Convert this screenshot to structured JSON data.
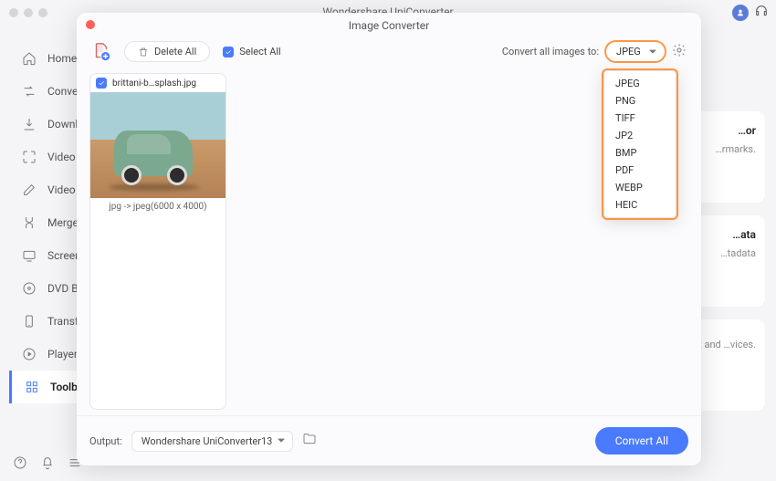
{
  "app_title": "Wondershare UniConverter",
  "sidebar": {
    "items": [
      {
        "label": "Home"
      },
      {
        "label": "Converter"
      },
      {
        "label": "Downloader"
      },
      {
        "label": "Video Compressor"
      },
      {
        "label": "Video Editor"
      },
      {
        "label": "Merger"
      },
      {
        "label": "Screen Recorder"
      },
      {
        "label": "DVD Burner"
      },
      {
        "label": "Transfer"
      },
      {
        "label": "Player"
      },
      {
        "label": "Toolbox"
      }
    ]
  },
  "tools": [
    {
      "title": "…or",
      "desc": "…rmarks."
    },
    {
      "title": "…ata",
      "desc": "…tadata"
    },
    {
      "title": "",
      "desc": "…t and …vices."
    }
  ],
  "modal": {
    "title": "Image Converter",
    "delete_all_label": "Delete All",
    "select_all_label": "Select All",
    "convert_to_label": "Convert all images to:",
    "selected_format": "JPEG",
    "formats": [
      "JPEG",
      "PNG",
      "TIFF",
      "JP2",
      "BMP",
      "PDF",
      "WEBP",
      "HEIC"
    ],
    "files": [
      {
        "name": "brittani-b…splash.jpg",
        "meta": "jpg -> jpeg(6000 x 4000)"
      }
    ],
    "output_label": "Output:",
    "output_path": "Wondershare UniConverter13",
    "convert_all_label": "Convert All"
  }
}
